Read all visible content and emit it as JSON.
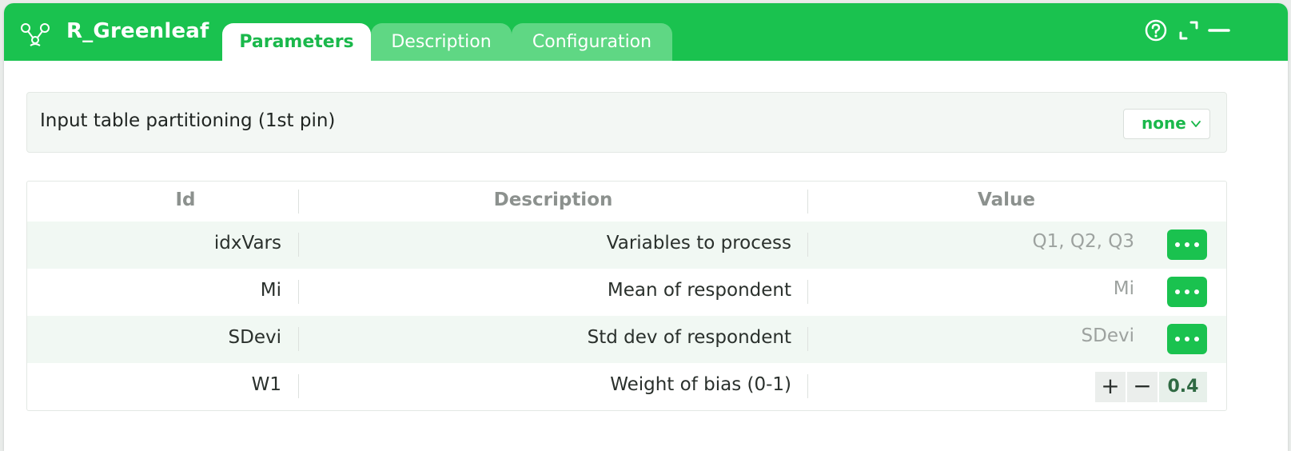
{
  "window": {
    "title": "R_Greenleaf"
  },
  "tabs": [
    {
      "label": "Parameters",
      "active": true
    },
    {
      "label": "Description",
      "active": false
    },
    {
      "label": "Configuration",
      "active": false
    }
  ],
  "title_controls": [
    "help-icon",
    "expand-icon",
    "minimize-icon"
  ],
  "partitioning": {
    "label": "Input table partitioning (1st pin)",
    "selected": "none"
  },
  "table": {
    "columns": [
      "Id",
      "Description",
      "Value"
    ],
    "rows": [
      {
        "id": "idxVars",
        "description": "Variables to process",
        "value": "Q1, Q2, Q3",
        "control": "more-button"
      },
      {
        "id": "Mi",
        "description": "Mean of respondent",
        "value": "Mi",
        "control": "more-button"
      },
      {
        "id": "SDevi",
        "description": "Std dev of respondent",
        "value": "SDevi",
        "control": "more-button"
      },
      {
        "id": "W1",
        "description": "Weight of bias (0-1)",
        "value": "0.4",
        "control": "stepper"
      }
    ],
    "stepper": {
      "plus": "+",
      "minus": "−"
    }
  },
  "colors": {
    "accent": "#1ac24f",
    "tab_inactive": "#5fd784",
    "row_shade": "#f1f8f3"
  }
}
